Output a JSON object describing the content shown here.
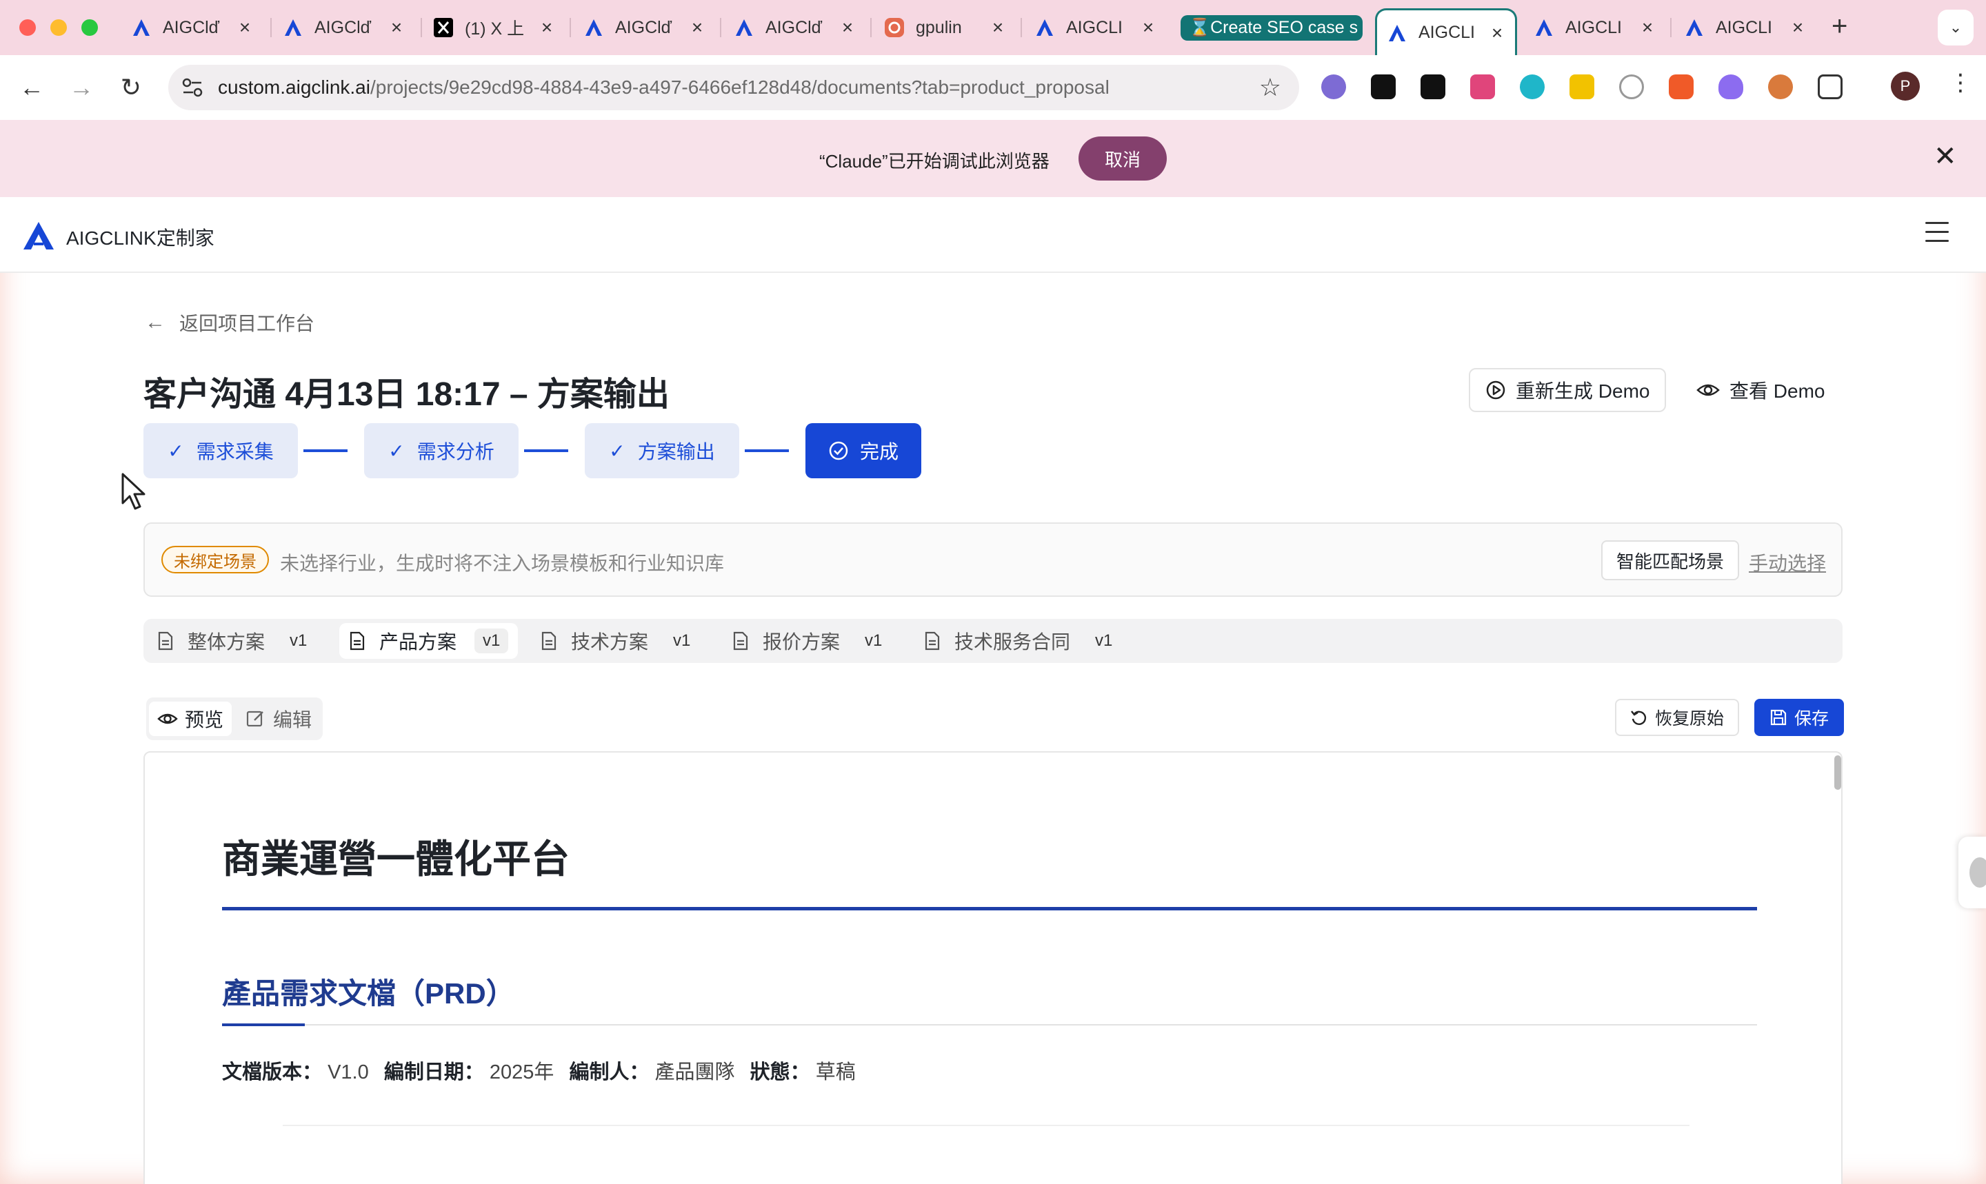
{
  "browser": {
    "tabs": [
      {
        "title": "AIGClď",
        "favicon": "aigclink-logo-icon",
        "close": "×"
      },
      {
        "title": "AIGClď",
        "favicon": "aigclink-logo-icon",
        "close": "×"
      },
      {
        "title": "(1) X 上",
        "favicon": "x-logo-icon",
        "close": "×"
      },
      {
        "title": "AIGClď",
        "favicon": "aigclink-logo-icon",
        "close": "×"
      },
      {
        "title": "AIGClď",
        "favicon": "aigclink-logo-icon",
        "close": "×"
      },
      {
        "title": "gpulin",
        "favicon": "gpulink-icon",
        "close": "×"
      },
      {
        "title": "AIGCLI",
        "favicon": "aigclink-logo-icon",
        "close": "×"
      },
      {
        "title": "⌛Create SEO case s",
        "favicon": "",
        "close": ""
      },
      {
        "title": "AIGCLI",
        "favicon": "aigclink-logo-icon",
        "close": "×"
      },
      {
        "title": "AIGCLI",
        "favicon": "aigclink-logo-icon",
        "close": "×"
      },
      {
        "title": "AIGCLI",
        "favicon": "aigclink-logo-icon",
        "close": "×"
      }
    ],
    "new_tab": "+",
    "tab_menu": "⌄",
    "url_host": "custom.aigclink.ai",
    "url_path": "/projects/9e29cd98-4884-43e9-a497-6466ef128d48/documents?tab=product_proposal",
    "profile_initial": "P",
    "nav": {
      "back": "←",
      "forward": "→",
      "reload": "↻",
      "star": "☆",
      "menu": "⋮"
    }
  },
  "debug_banner": {
    "text": "“Claude”已开始调试此浏览器",
    "cancel_label": "取消",
    "close": "✕"
  },
  "app": {
    "name": "AIGCLINK定制家",
    "brand_color": "#1747d6"
  },
  "page": {
    "back_label": "返回项目工作台",
    "title": "客户沟通 4月13日 18:17 – 方案输出",
    "regen_demo": "重新生成 Demo",
    "view_demo": "查看 Demo",
    "steps": [
      {
        "label": "需求采集",
        "status": "done"
      },
      {
        "label": "需求分析",
        "status": "done"
      },
      {
        "label": "方案输出",
        "status": "done"
      },
      {
        "label": "完成",
        "status": "current"
      }
    ],
    "scene": {
      "badge": "未绑定场景",
      "text": "未选择行业，生成时将不注入场景模板和行业知识库",
      "smart_match": "智能匹配场景",
      "manual": "手动选择"
    },
    "doc_tabs": [
      {
        "label": "整体方案",
        "version": "v1",
        "active": false
      },
      {
        "label": "产品方案",
        "version": "v1",
        "active": true
      },
      {
        "label": "技术方案",
        "version": "v1",
        "active": false
      },
      {
        "label": "报价方案",
        "version": "v1",
        "active": false
      },
      {
        "label": "技术服务合同",
        "version": "v1",
        "active": false
      }
    ],
    "mode": {
      "preview": "预览",
      "edit": "编辑"
    },
    "restore_label": "恢复原始",
    "save_label": "保存"
  },
  "document": {
    "h1": "商業運營一體化平台",
    "h2": "產品需求文檔（PRD）",
    "meta": {
      "version_label": "文檔版本：",
      "version_value": "V1.0",
      "date_label": "編制日期：",
      "date_value": "2025年",
      "author_label": "編制人：",
      "author_value": "產品團隊",
      "status_label": "狀態：",
      "status_value": "草稿"
    }
  }
}
